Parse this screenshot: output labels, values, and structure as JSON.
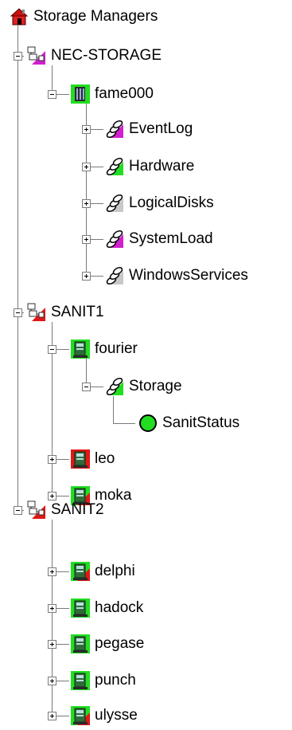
{
  "tree": {
    "root": {
      "label": "Storage Managers",
      "icon": "home-icon"
    },
    "nodes": [
      {
        "label": "NEC-STORAGE",
        "icon": "network-manager-icon",
        "status": "#d020d0"
      },
      {
        "label": "fame000",
        "icon": "storage-device-icon",
        "status": "#22dd22"
      },
      {
        "label": "EventLog",
        "icon": "disk-stack-icon",
        "status": "#d020d0"
      },
      {
        "label": "Hardware",
        "icon": "disk-stack-icon",
        "status": "#22dd22"
      },
      {
        "label": "LogicalDisks",
        "icon": "disk-stack-icon",
        "status": "#c8c8c8"
      },
      {
        "label": "SystemLoad",
        "icon": "disk-stack-icon",
        "status": "#d020d0"
      },
      {
        "label": "WindowsServices",
        "icon": "disk-stack-icon",
        "status": "#c8c8c8"
      },
      {
        "label": "SANIT1",
        "icon": "network-manager-icon",
        "status": "#e01818"
      },
      {
        "label": "fourier",
        "icon": "server-icon",
        "status": "#22dd22"
      },
      {
        "label": "Storage",
        "icon": "disk-stack-icon",
        "status": "#22dd22"
      },
      {
        "label": "SanitStatus",
        "icon": "status-circle-icon",
        "status": "#22dd22"
      },
      {
        "label": "leo",
        "icon": "server-icon",
        "status": "#e01818"
      },
      {
        "label": "moka",
        "icon": "server-icon",
        "status": "#22dd22"
      },
      {
        "label": "SANIT2",
        "icon": "network-manager-icon",
        "status": "#e01818"
      },
      {
        "label": "delphi",
        "icon": "server-icon",
        "status": "#22dd22"
      },
      {
        "label": "hadock",
        "icon": "server-icon",
        "status": "#22dd22"
      },
      {
        "label": "pegase",
        "icon": "server-icon",
        "status": "#22dd22"
      },
      {
        "label": "punch",
        "icon": "server-icon",
        "status": "#22dd22"
      },
      {
        "label": "ulysse",
        "icon": "server-icon",
        "status": "#22dd22"
      }
    ]
  }
}
